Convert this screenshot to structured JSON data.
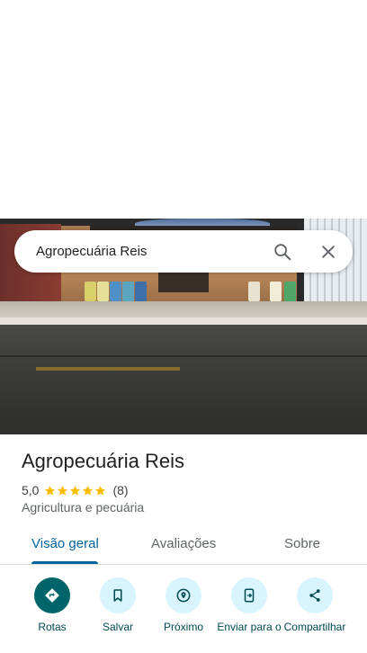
{
  "search": {
    "value": "Agropecuária Reis",
    "search_icon": "search-icon",
    "close_icon": "close-icon"
  },
  "place": {
    "name": "Agropecuária Reis",
    "rating": "5,0",
    "stars": 5,
    "review_count": "(8)",
    "category": "Agricultura e pecuária",
    "star_color": "#fbbc04"
  },
  "tabs": [
    {
      "label": "Visão geral",
      "active": true
    },
    {
      "label": "Avaliações",
      "active": false
    },
    {
      "label": "Sobre",
      "active": false
    }
  ],
  "actions": [
    {
      "label": "Rotas",
      "icon": "directions-icon"
    },
    {
      "label": "Salvar",
      "icon": "bookmark-icon"
    },
    {
      "label": "Próximo",
      "icon": "nearby-icon"
    },
    {
      "label": "Enviar para o",
      "icon": "send-to-phone-icon"
    },
    {
      "label": "Compartilhar",
      "icon": "share-icon"
    }
  ],
  "colors": {
    "accent": "#00639a",
    "primary_action": "#00656a",
    "action_bg": "#d7f4ff"
  }
}
